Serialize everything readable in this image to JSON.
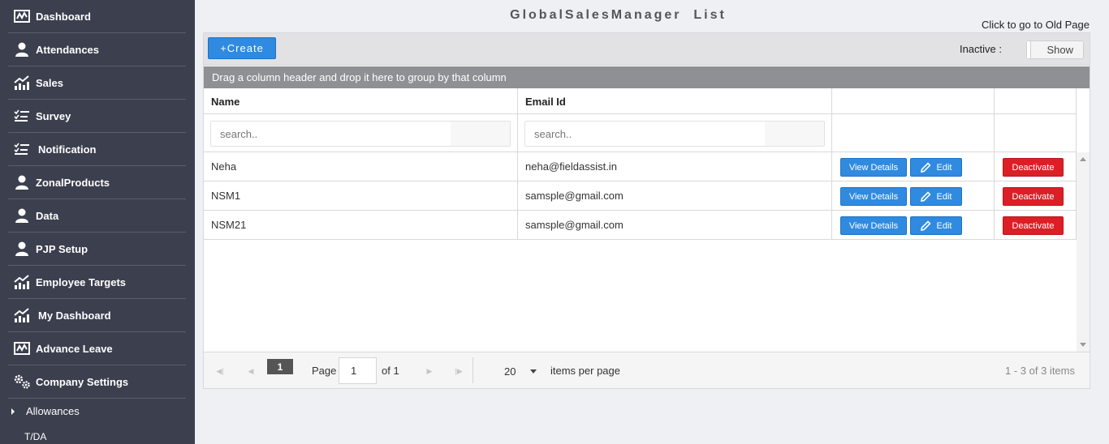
{
  "sidebar": {
    "items": [
      {
        "label": "Dashboard",
        "icon": "monitor-chart-icon"
      },
      {
        "label": "Attendances",
        "icon": "user-icon"
      },
      {
        "label": "Sales",
        "icon": "trend-up-icon"
      },
      {
        "label": "Survey",
        "icon": "checklist-icon"
      },
      {
        "label": "Notification",
        "icon": "checklist-icon"
      },
      {
        "label": "ZonalProducts",
        "icon": "user-icon"
      },
      {
        "label": "Data",
        "icon": "user-icon"
      },
      {
        "label": "PJP Setup",
        "icon": "user-icon"
      },
      {
        "label": "Employee Targets",
        "icon": "trend-up-icon"
      },
      {
        "label": "My Dashboard",
        "icon": "trend-up-icon"
      },
      {
        "label": "Advance Leave",
        "icon": "monitor-chart-icon"
      },
      {
        "label": "Company Settings",
        "icon": "gears-icon"
      }
    ],
    "sub_item": "Allowances",
    "cut_item": "T/DA"
  },
  "page": {
    "title": "GlobalSalesManager  List",
    "old_page_link": "Click to go to Old Page"
  },
  "toolbar": {
    "create_label": "+Create",
    "inactive_label": "Inactive :",
    "toggle_label": "Show"
  },
  "group_bar": "Drag a column header and drop it here to group by that column",
  "table": {
    "columns": [
      "Name",
      "Email Id"
    ],
    "search_placeholder": "search..",
    "rows": [
      {
        "name": "Neha",
        "email": "neha@fieldassist.in"
      },
      {
        "name": "NSM1",
        "email": "samsple@gmail.com"
      },
      {
        "name": "NSM21",
        "email": "samsple@gmail.com"
      }
    ],
    "view_label": "View Details",
    "edit_label": "Edit",
    "deactivate_label": "Deactivate"
  },
  "pager": {
    "current_page": "1",
    "page_label": "Page",
    "page_input": "1",
    "of_label": "of 1",
    "page_size": "20",
    "items_per_page": "items per page",
    "info": "1 - 3 of 3 items"
  },
  "colors": {
    "sidebar": "#3b3f4e",
    "primary": "#2f8ae0",
    "danger": "#dc1f26"
  }
}
